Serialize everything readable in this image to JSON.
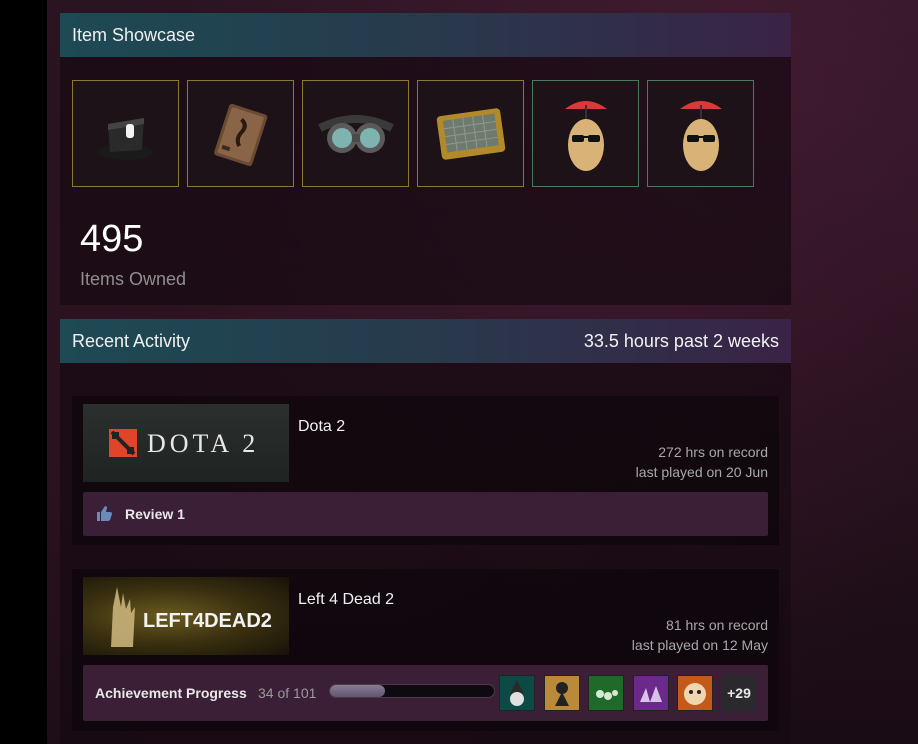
{
  "showcase": {
    "title": "Item Showcase",
    "items": [
      {
        "icon": "top-hat-icon"
      },
      {
        "icon": "dossier-icon"
      },
      {
        "icon": "goggles-icon"
      },
      {
        "icon": "pda-screen-icon"
      },
      {
        "icon": "potato-pet-icon"
      },
      {
        "icon": "potato-pet-icon"
      }
    ],
    "count": "495",
    "count_label": "Items Owned"
  },
  "activity": {
    "title": "Recent Activity",
    "summary": "33.5 hours past 2 weeks",
    "games": [
      {
        "name": "Dota 2",
        "logo_text": "DOTA 2",
        "hours": "272 hrs on record",
        "last_played": "last played on 20 Jun",
        "review_label": "Review 1"
      },
      {
        "name": "Left 4 Dead 2",
        "logo_text": "LEFT4DEAD2",
        "hours": "81 hrs on record",
        "last_played": "last played on 12 May",
        "achievement_label": "Achievement Progress",
        "achievement_count": "34 of 101",
        "achievement_progress": 0.337,
        "achievement_more": "+29"
      }
    ]
  },
  "colors": {
    "header_gradient_start": "#1d4a54",
    "header_gradient_end": "#3a2346",
    "slot_border_gold": "#8a7a2e",
    "slot_border_green": "#4a7a5e",
    "subbar": "#3a1f36"
  }
}
